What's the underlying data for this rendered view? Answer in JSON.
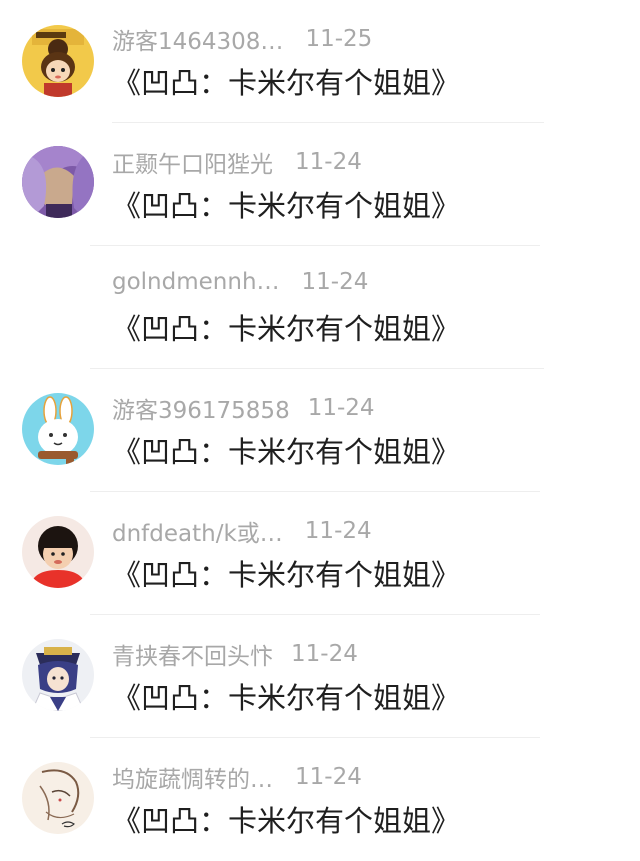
{
  "comments": [
    {
      "username": "游客1464308…",
      "date": "11-25",
      "text": "《凹凸：卡米尔有个姐姐》",
      "avatar_icon": "avatar-cartoon-icon"
    },
    {
      "username": "正颞午口阳狴光",
      "date": "11-24",
      "text": "《凹凸：卡米尔有个姐姐》",
      "avatar_icon": "avatar-anime-purple-icon"
    },
    {
      "username": "golndmennh…",
      "date": "11-24",
      "text": "《凹凸：卡米尔有个姐姐》",
      "avatar_icon": ""
    },
    {
      "username": "游客396175858",
      "date": "11-24",
      "text": "《凹凸：卡米尔有个姐姐》",
      "avatar_icon": "avatar-rabbit-icon"
    },
    {
      "username": "dnfdeath/k或…",
      "date": "11-24",
      "text": "《凹凸：卡米尔有个姐姐》",
      "avatar_icon": "avatar-child-icon"
    },
    {
      "username": "青挟春不回头忭",
      "date": "11-24",
      "text": "《凹凸：卡米尔有个姐姐》",
      "avatar_icon": "avatar-anime-blue-icon"
    },
    {
      "username": "坞旋蔬惆转的…",
      "date": "11-24",
      "text": "《凹凸：卡米尔有个姐姐》",
      "avatar_icon": "avatar-sketch-icon"
    }
  ]
}
